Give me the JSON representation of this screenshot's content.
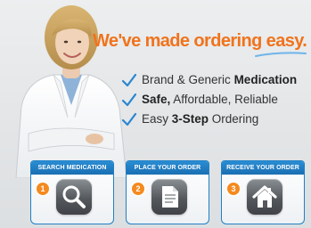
{
  "headline": "We've made ordering easy.",
  "features": [
    {
      "plain_before": "Brand & Generic ",
      "bold": "Medication",
      "plain_after": ""
    },
    {
      "plain_before": "",
      "bold": "Safe,",
      "plain_after": " Affordable, Reliable"
    },
    {
      "plain_before": "Easy ",
      "bold": "3-Step",
      "plain_after": " Ordering"
    }
  ],
  "steps": [
    {
      "number": "1",
      "title": "SEARCH MEDICATION",
      "icon": "magnifier-icon"
    },
    {
      "number": "2",
      "title": "PLACE YOUR ORDER",
      "icon": "document-icon"
    },
    {
      "number": "3",
      "title": "RECEIVE YOUR ORDER",
      "icon": "house-icon"
    }
  ],
  "colors": {
    "headline": "#f0731c",
    "check": "#2a86d0",
    "step_header": "#1f80c4",
    "step_number": "#f58a1f"
  }
}
